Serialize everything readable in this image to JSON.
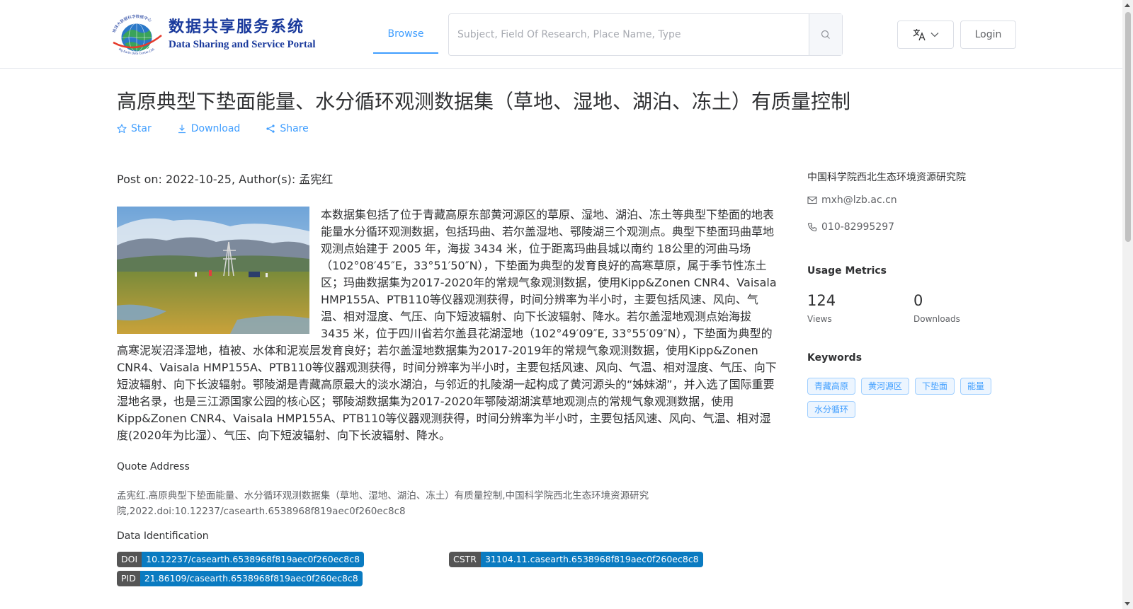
{
  "header": {
    "logo": {
      "cn": "数据共享服务系统",
      "en": "Data Sharing and Service Portal",
      "badge_text": "地球大数据科学数据中心",
      "badge_sub": "Big Earth Data Center,CAS"
    },
    "nav": {
      "browse": "Browse"
    },
    "search": {
      "placeholder": "Subject, Field Of Research, Place Name, Type",
      "icon": "search-icon"
    },
    "lang_icon": "translate-icon",
    "login": "Login"
  },
  "dataset": {
    "title": "高原典型下垫面能量、水分循环观测数据集（草地、湿地、湖泊、冻土）有质量控制",
    "actions": {
      "star": "Star",
      "download": "Download",
      "share": "Share"
    },
    "post_meta": "Post on: 2022-10-25, Author(s): 孟宪红",
    "description": "本数据集包括了位于青藏高原东部黄河源区的草原、湿地、湖泊、冻土等典型下垫面的地表能量水分循环观测数据，包括玛曲、若尔盖湿地、鄂陵湖三个观测点。典型下垫面玛曲草地观测点始建于 2005 年，海拔 3434 米，位于距离玛曲县城以南约 18公里的河曲马场（102°08′45″E，33°51′50″N），下垫面为典型的发育良好的高寒草原，属于季节性冻土区；玛曲数据集为2017-2020年的常规气象观测数据，使用Kipp&Zonen CNR4、Vaisala HMP155A、PTB110等仪器观测获得，时间分辨率为半小时，主要包括风速、风向、气温、相对湿度、气压、向下短波辐射、向下长波辐射、降水。若尔盖湿地观测点始海拔 3435 米，位于四川省若尔盖县花湖湿地（102°49′09″E, 33°55′09″N），下垫面为典型的高寒泥炭沼泽湿地，植被、水体和泥炭层发育良好；若尔盖湿地数据集为2017-2019年的常规气象观测数据，使用Kipp&Zonen CNR4、Vaisala HMP155A、PTB110等仪器观测获得，时间分辨率为半小时，主要包括风速、风向、气温、相对湿度、气压、向下短波辐射、向下长波辐射。鄂陵湖是青藏高原最大的淡水湖泊，与邻近的扎陵湖一起构成了黄河源头的“姊妹湖”，并入选了国际重要湿地名录，也是三江源国家公园的核心区；鄂陵湖数据集为2017-2020年鄂陵湖湖滨草地观测点的常规气象观测数据，使用Kipp&Zonen CNR4、Vaisala HMP155A、PTB110等仪器观测获得，时间分辨率为半小时，主要包括风速、风向、气温、相对湿度(2020年为比湿）、气压、向下短波辐射、向下长波辐射、降水。",
    "quote": {
      "label": "Quote Address",
      "text": "孟宪红.高原典型下垫面能量、水分循环观测数据集（草地、湿地、湖泊、冻土）有质量控制,中国科学院西北生态环境资源研究院,2022.doi:10.12237/casearth.6538968f819aec0f260ec8c8"
    },
    "identification": {
      "label": "Data Identification",
      "doi": {
        "key": "DOI",
        "value": "10.12237/casearth.6538968f819aec0f260ec8c8"
      },
      "cstr": {
        "key": "CSTR",
        "value": "31104.11.casearth.6538968f819aec0f260ec8c8"
      },
      "pid": {
        "key": "PID",
        "value": "21.86109/casearth.6538968f819aec0f260ec8c8"
      }
    }
  },
  "sidebar": {
    "org": "中国科学院西北生态环境资源研究院",
    "email": "mxh@lzb.ac.cn",
    "phone": "010-82995297",
    "usage": {
      "title": "Usage Metrics",
      "views": {
        "value": "124",
        "label": "Views"
      },
      "downloads": {
        "value": "0",
        "label": "Downloads"
      }
    },
    "keywords": {
      "title": "Keywords",
      "items": [
        "青藏高原",
        "黄河源区",
        "下垫面",
        "能量",
        "水分循环"
      ]
    }
  },
  "colors": {
    "accent": "#409eff",
    "ident_value_bg": "#0a7bc1",
    "ident_key_bg": "#555555",
    "logo_blue": "#1a3a9c"
  }
}
